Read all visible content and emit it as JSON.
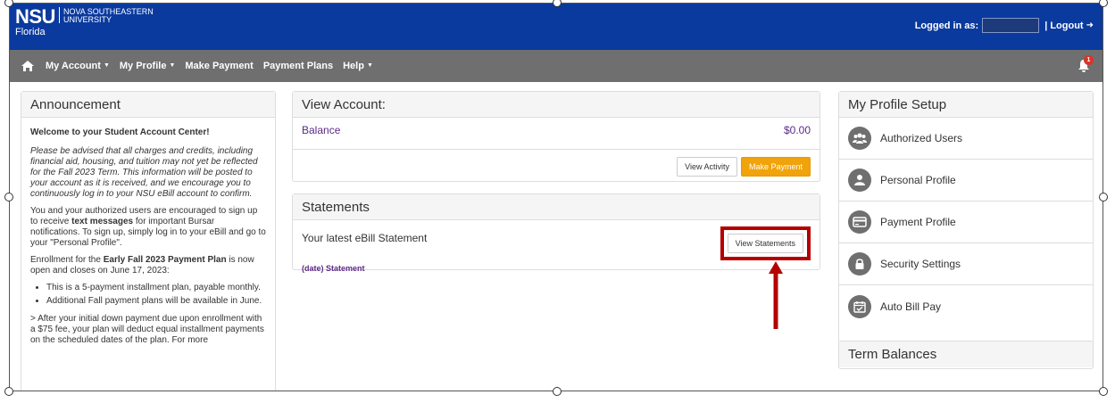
{
  "header": {
    "logo_nsu": "NSU",
    "logo_university_line1": "NOVA SOUTHEASTERN",
    "logo_university_line2": "UNIVERSITY",
    "logo_florida": "Florida",
    "logged_in_label": "Logged in as:",
    "logout_label": "| Logout"
  },
  "nav": {
    "items": [
      {
        "label": "My Account",
        "dropdown": true
      },
      {
        "label": "My Profile",
        "dropdown": true
      },
      {
        "label": "Make Payment",
        "dropdown": false
      },
      {
        "label": "Payment Plans",
        "dropdown": false
      },
      {
        "label": "Help",
        "dropdown": true
      }
    ],
    "notification_count": "1"
  },
  "announcement": {
    "title": "Announcement",
    "welcome": "Welcome to your Student Account Center!",
    "p1": "Please be advised that all charges and credits, including financial aid, housing, and tuition may not yet be reflected for the Fall 2023 Term. This information will be posted to your account as it is received, and we encourage you to continuously log in to your NSU eBill account to confirm.",
    "p2_a": "You and your authorized users are encouraged to sign up to receive ",
    "p2_bold": "text messages",
    "p2_b": " for important Bursar notifications. To sign up, simply log in to your eBill and go to your \"Personal Profile\".",
    "p3_a": "Enrollment for the ",
    "p3_bold": "Early Fall 2023 Payment Plan",
    "p3_b": " is now open and closes on June 17, 2023:",
    "bullets": [
      "This is a 5-payment installment plan, payable monthly.",
      "Additional Fall payment plans will be available in June."
    ],
    "p4": "> After your initial down payment due upon enrollment with a $75 fee, your plan will deduct equal installment payments on the scheduled dates of the plan. For more"
  },
  "view_account": {
    "title": "View Account:",
    "balance_label": "Balance",
    "balance_value": "$0.00",
    "view_activity": "View Activity",
    "make_payment": "Make Payment"
  },
  "statements": {
    "title": "Statements",
    "latest_label": "Your latest eBill Statement",
    "view_statements": "View Statements",
    "statement_link": "(date) Statement"
  },
  "profile_setup": {
    "title": "My Profile Setup",
    "items": [
      {
        "label": "Authorized Users",
        "icon": "users-icon"
      },
      {
        "label": "Personal Profile",
        "icon": "user-icon"
      },
      {
        "label": "Payment Profile",
        "icon": "credit-card-icon"
      },
      {
        "label": "Security Settings",
        "icon": "lock-icon"
      },
      {
        "label": "Auto Bill Pay",
        "icon": "calendar-check-icon"
      }
    ]
  },
  "term_balances": {
    "title": "Term Balances"
  },
  "colors": {
    "header_blue": "#0a3a9e",
    "nav_gray": "#6f6f6f",
    "accent_purple": "#5b2a86",
    "button_orange": "#f0a30a",
    "highlight_red": "#b40000"
  }
}
